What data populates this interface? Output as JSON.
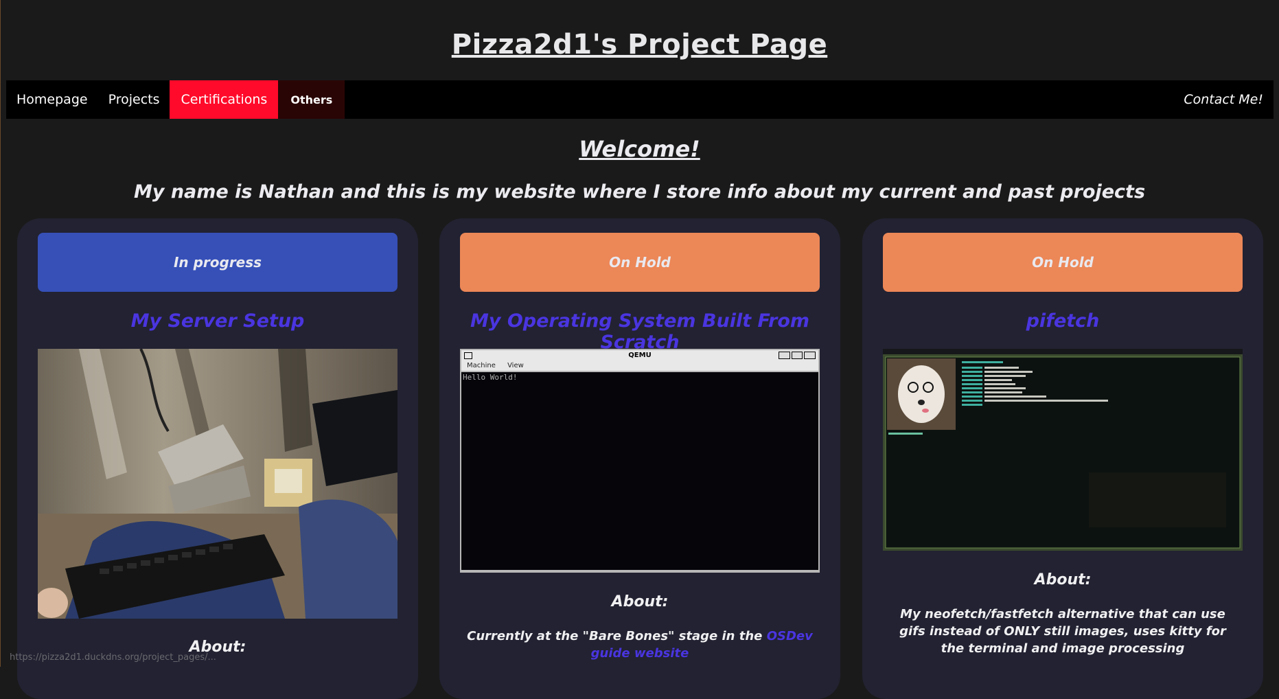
{
  "site": {
    "title": "Pizza2d1's Project Page"
  },
  "nav": {
    "items": [
      {
        "label": "Homepage"
      },
      {
        "label": "Projects"
      },
      {
        "label": "Certifications"
      },
      {
        "label": "Others"
      }
    ],
    "contact": "Contact Me!"
  },
  "hero": {
    "welcome": "Welcome!",
    "intro": "My name is Nathan and this is my website where I store info about my current and past projects"
  },
  "cards": [
    {
      "status": "In progress",
      "status_color": "#3650b8",
      "title": "My Server Setup",
      "about_label": "About:",
      "image_icon": "server-photo"
    },
    {
      "status": "On Hold",
      "status_color": "#ec8757",
      "title": "My Operating System Built From Scratch",
      "about_label": "About:",
      "image_icon": "qemu-screenshot",
      "qemu": {
        "window_title": "QEMU",
        "menu_machine": "Machine",
        "menu_view": "View",
        "console_text": "Hello World!"
      },
      "desc_prefix": "Currently at the \"Bare Bones\" stage in the",
      "desc_link": "OSDev guide website"
    },
    {
      "status": "On Hold",
      "status_color": "#ec8757",
      "title": "pifetch",
      "about_label": "About:",
      "image_icon": "pifetch-screenshot",
      "desc": "My neofetch/fastfetch alternative that can use gifs instead of ONLY still images, uses kitty for the terminal and image processing"
    }
  ],
  "browser_status": {
    "url": "https://pizza2d1.duckdns.org/project_pages/..."
  },
  "colors": {
    "accent_link": "#4a35e0",
    "nav_active": "#ff0a2a",
    "card_bg": "#222232"
  }
}
